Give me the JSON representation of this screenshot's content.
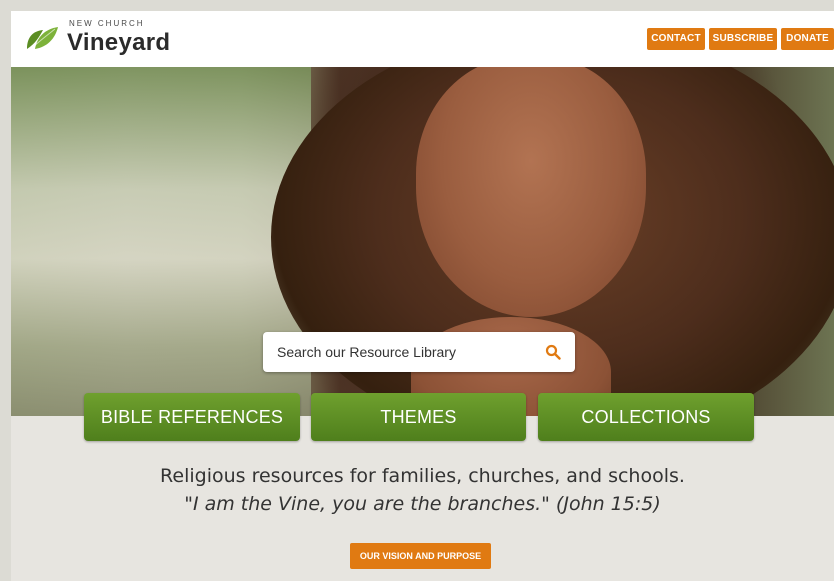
{
  "header": {
    "logo_small": "NEW CHURCH",
    "logo_big": "Vineyard",
    "buttons": [
      "CONTACT",
      "SUBSCRIBE",
      "DONATE"
    ]
  },
  "search": {
    "placeholder": "Search our Resource Library",
    "icon": "search-icon"
  },
  "categories": [
    "BIBLE REFERENCES",
    "THEMES",
    "COLLECTIONS"
  ],
  "tagline": "Religious resources for families, churches, and schools.",
  "quote": "\"I am the Vine, you are the branches.\" (John 15:5)",
  "vision_button": "OUR VISION AND PURPOSE",
  "colors": {
    "accent_orange": "#e07a12",
    "brand_green": "#5b8d23",
    "background": "#e7e5e0"
  }
}
